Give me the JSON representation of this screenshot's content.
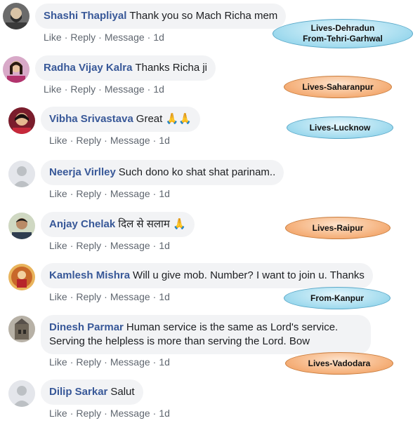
{
  "comments": [
    {
      "name": "Shashi Thapliyal",
      "text": "Thank you so Mach Richa mem",
      "actions": {
        "like": "Like",
        "reply": "Reply",
        "message": "Message",
        "time": "1d"
      },
      "avatar": "person-with-beard-avatar"
    },
    {
      "name": "Radha Vijay Kalra",
      "text": "Thanks Richa ji",
      "actions": {
        "like": "Like",
        "reply": "Reply",
        "message": "Message",
        "time": "1d"
      },
      "avatar": "woman-avatar"
    },
    {
      "name": "Vibha Srivastava",
      "text": "Great 🙏🙏",
      "actions": {
        "like": "Like",
        "reply": "Reply",
        "message": "Message",
        "time": "1d"
      },
      "avatar": "woman-red-avatar"
    },
    {
      "name": "Neerja Virlley",
      "text": "Such dono ko shat shat parinam..",
      "actions": {
        "like": "Like",
        "reply": "Reply",
        "message": "Message",
        "time": "1d"
      },
      "avatar": "default-silhouette-avatar"
    },
    {
      "name": "Anjay Chelak",
      "text": "दिल से सलाम 🙏",
      "actions": {
        "like": "Like",
        "reply": "Reply",
        "message": "Message",
        "time": "1d"
      },
      "avatar": "man-avatar"
    },
    {
      "name": "Kamlesh Mishra",
      "text": "Will u give mob. Number? I want to join u. Thanks",
      "actions": {
        "like": "Like",
        "reply": "Reply",
        "message": "Message",
        "time": "1d"
      },
      "avatar": "deity-avatar"
    },
    {
      "name": "Dinesh Parmar",
      "text": "Human service is the same as Lord's service. Serving the helpless is more than serving the Lord. Bow",
      "actions": {
        "like": "Like",
        "reply": "Reply",
        "message": "Message",
        "time": "1d"
      },
      "avatar": "building-avatar"
    },
    {
      "name": "Dilip Sarkar",
      "text": "Salut",
      "actions": {
        "like": "Like",
        "reply": "Reply",
        "message": "Message",
        "time": "1d"
      },
      "avatar": "default-silhouette-avatar"
    }
  ],
  "annotations": [
    {
      "line1": "Lives-Dehradun",
      "line2": "From-Tehri-Garhwal",
      "color": "#a9def0"
    },
    {
      "line1": "Lives-Saharanpur",
      "line2": "",
      "color": "#f6b582"
    },
    {
      "line1": "Lives-Lucknow",
      "line2": "",
      "color": "#a9def0"
    },
    {
      "line1": "Lives-Raipur",
      "line2": "",
      "color": "#f6b582"
    },
    {
      "line1": "From-Kanpur",
      "line2": "",
      "color": "#a9def0"
    },
    {
      "line1": "Lives-Vadodara",
      "line2": "",
      "color": "#f6b582"
    }
  ],
  "colors": {
    "name_link": "#385898",
    "bubble_bg": "#f2f3f5",
    "action_text": "#606770"
  }
}
